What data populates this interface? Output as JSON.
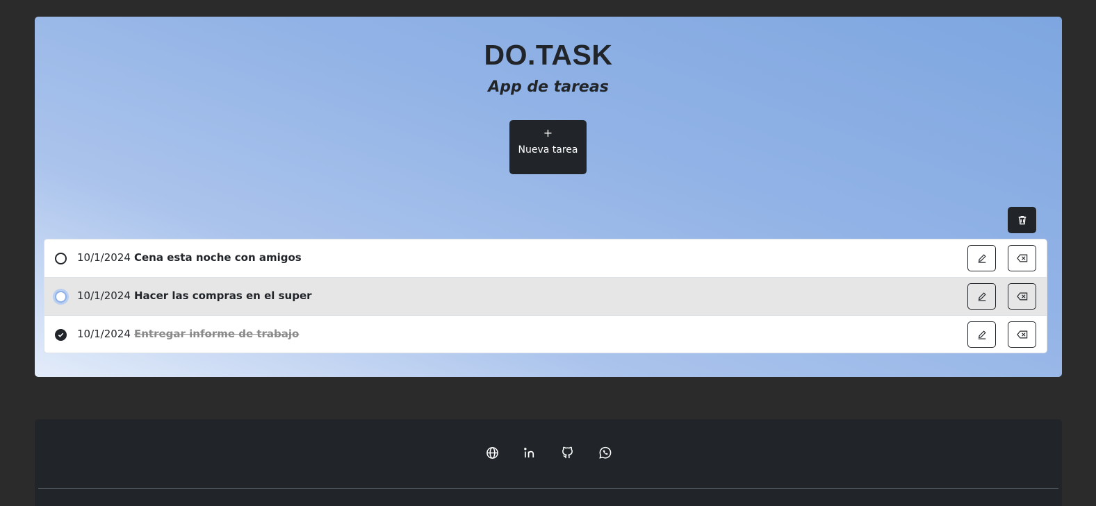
{
  "header": {
    "title": "DO.TASK",
    "subtitle": "App de tareas"
  },
  "new_task_button": {
    "icon": "+",
    "label": "Nueva tarea"
  },
  "clear_button": {
    "icon": "trash-icon"
  },
  "tasks": [
    {
      "date": "10/1/2024",
      "text": "Cena esta noche con amigos",
      "completed": false
    },
    {
      "date": "10/1/2024",
      "text": "Hacer las compras en el super",
      "completed": false
    },
    {
      "date": "10/1/2024",
      "text": "Entregar informe de trabajo",
      "completed": true
    }
  ],
  "footer": {
    "socials": [
      "globe-icon",
      "linkedin-icon",
      "github-icon",
      "whatsapp-icon"
    ]
  },
  "colors": {
    "background": "#2b2b2b",
    "dark": "#212529",
    "gradient_start": "#e3ecfa",
    "gradient_end": "#7ea6e0",
    "completed_text": "#8a8a8a"
  }
}
